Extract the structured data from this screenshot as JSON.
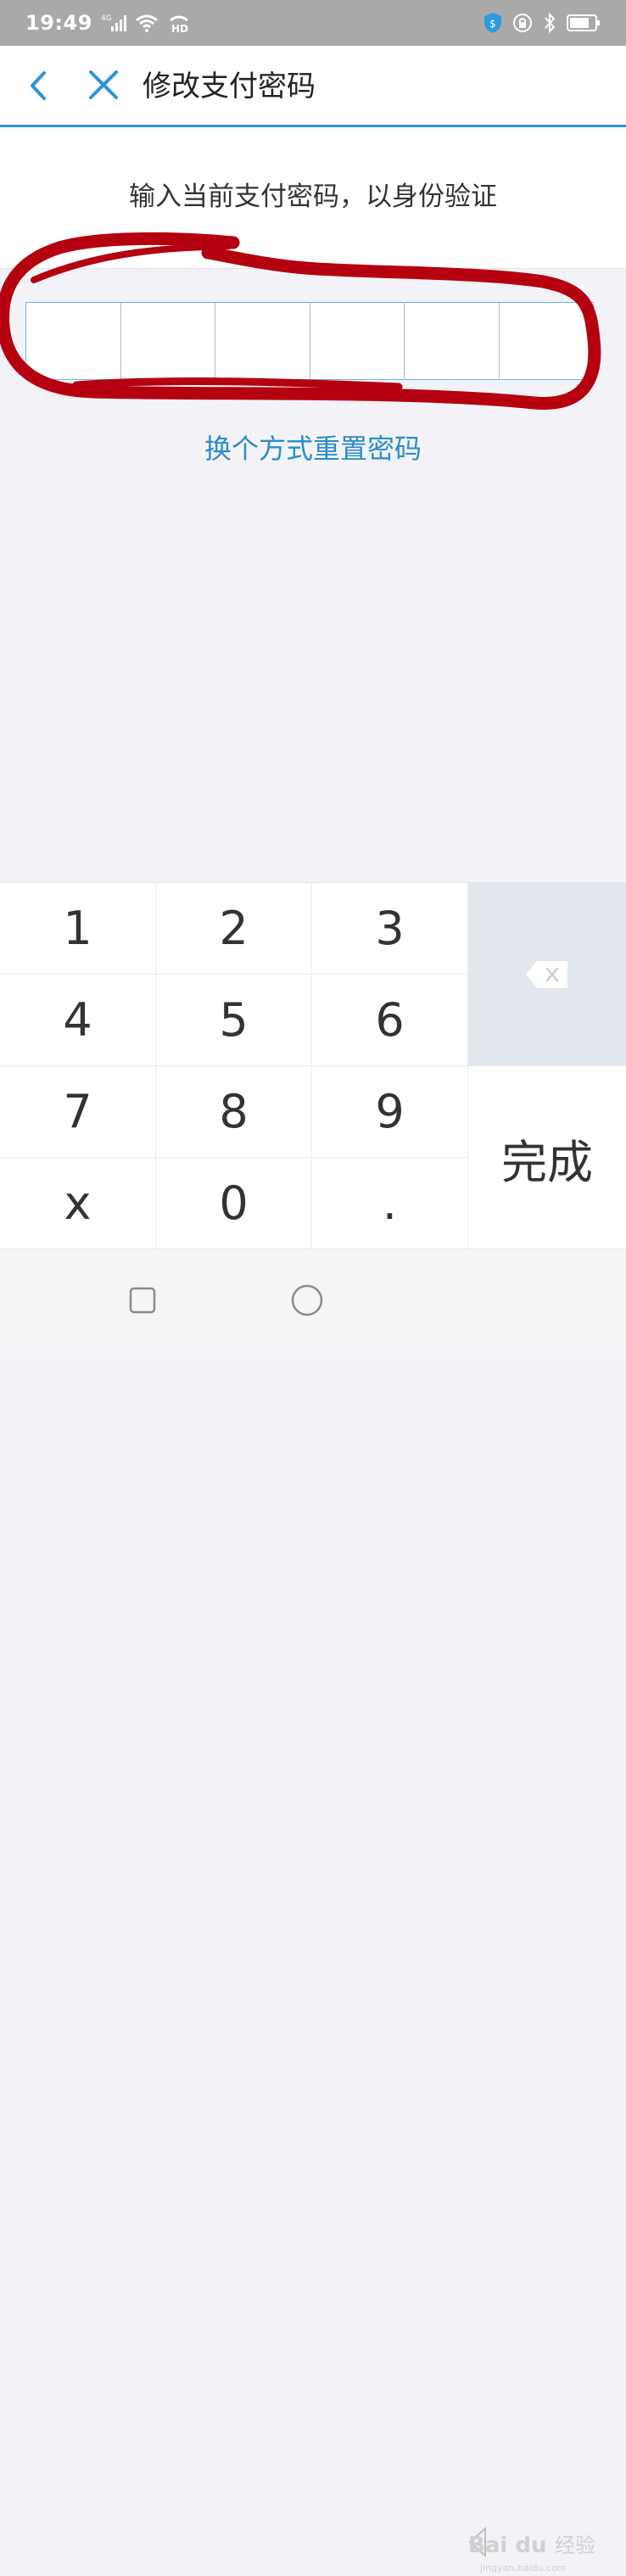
{
  "status_bar": {
    "time": "19:49",
    "network_label": "4G",
    "hd_label": "HD"
  },
  "header": {
    "title": "修改支付密码",
    "back_icon": "chevron-left-icon",
    "close_icon": "close-icon"
  },
  "prompt": {
    "text": "输入当前支付密码，以身份验证"
  },
  "pin_input": {
    "length": 6,
    "filled": 0
  },
  "reset_link": {
    "label": "换个方式重置密码"
  },
  "keypad": {
    "keys": [
      {
        "label": "1"
      },
      {
        "label": "2"
      },
      {
        "label": "3"
      },
      {
        "label": "4"
      },
      {
        "label": "5"
      },
      {
        "label": "6"
      },
      {
        "label": "7"
      },
      {
        "label": "8"
      },
      {
        "label": "9"
      },
      {
        "label": "x"
      },
      {
        "label": "0"
      },
      {
        "label": "."
      }
    ],
    "delete_icon": "backspace-icon",
    "done_label": "完成"
  },
  "watermark": {
    "brand": "Bai du",
    "suffix": "经验",
    "url": "jingyan.baidu.com"
  },
  "colors": {
    "accent": "#2b95d6",
    "annotation": "#b50010",
    "status_bar": "#a9a9a9",
    "delete_key_bg": "#e2e6ed"
  }
}
